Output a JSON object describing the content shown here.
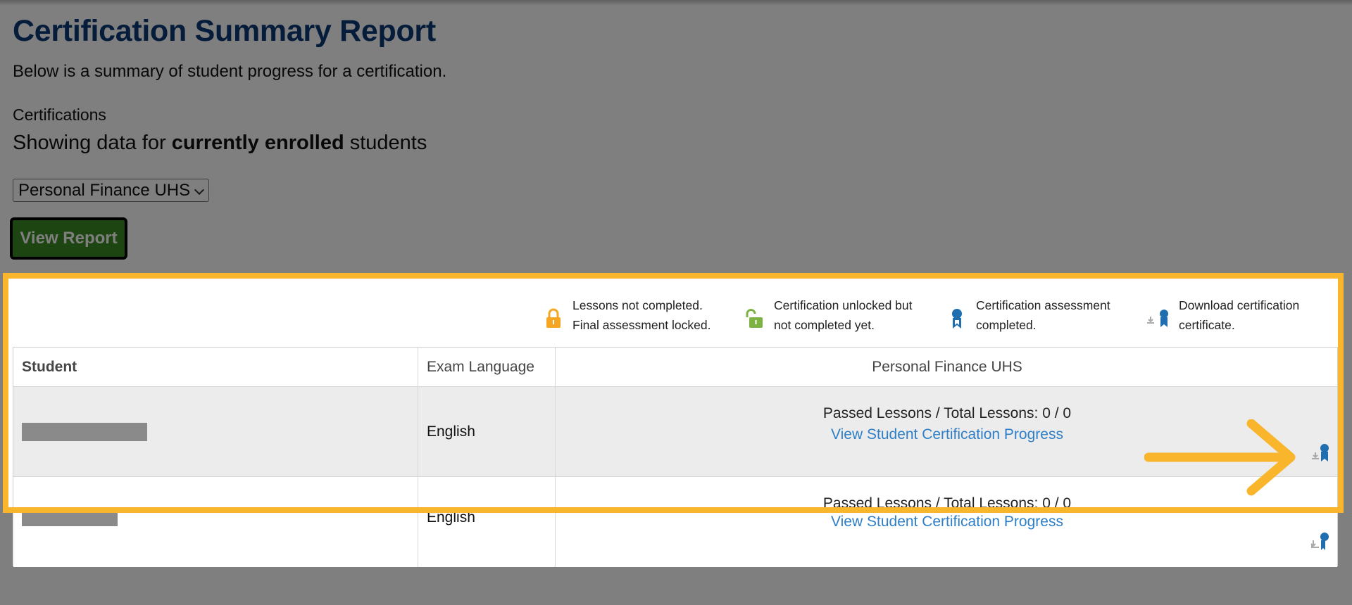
{
  "header": {
    "title": "Certification Summary Report",
    "subtitle": "Below is a summary of student progress for a certification."
  },
  "filters": {
    "certifications_label": "Certifications",
    "showing_prefix": "Showing data for ",
    "showing_bold": "currently enrolled",
    "showing_suffix": " students",
    "selected_certification": "Personal Finance UHS",
    "view_report_label": "View Report"
  },
  "legend": {
    "items": [
      {
        "icon": "lock-icon",
        "line1": "Lessons not completed.",
        "line2": "Final assessment locked."
      },
      {
        "icon": "unlock-icon",
        "line1": "Certification unlocked but",
        "line2": "not completed yet."
      },
      {
        "icon": "ribbon-icon",
        "line1": "Certification assessment",
        "line2": "completed."
      },
      {
        "icon": "download-ribbon-icon",
        "line1": "Download certification",
        "line2": "certificate."
      }
    ]
  },
  "table": {
    "columns": [
      "Student",
      "Exam Language",
      "Personal Finance UHS"
    ],
    "rows": [
      {
        "student": "",
        "language": "English",
        "progress": "Passed Lessons / Total Lessons: 0 / 0",
        "link": "View Student Certification Progress"
      },
      {
        "student": "",
        "language": "English",
        "progress": "Passed Lessons / Total Lessons: 0 / 0",
        "link": "View Student Certification Progress"
      }
    ]
  },
  "colors": {
    "title": "#0b3a77",
    "button": "#3a8a22",
    "highlight": "#f9b52c",
    "link": "#2f7fc8",
    "lock": "#f5a623",
    "unlock": "#7cb342",
    "ribbon": "#1f6fb0"
  }
}
